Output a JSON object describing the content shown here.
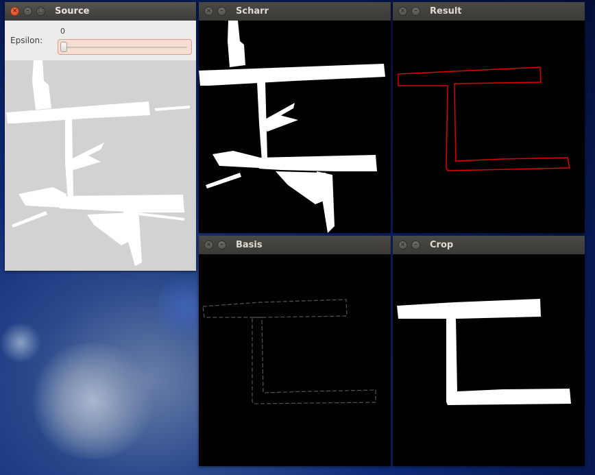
{
  "windows": {
    "source": {
      "title": "Source",
      "trackbar": {
        "label": "Epsilon:",
        "value": "0",
        "fraction": 0
      }
    },
    "scharr": {
      "title": "Scharr"
    },
    "result": {
      "title": "Result"
    },
    "basis": {
      "title": "Basis"
    },
    "crop": {
      "title": "Crop"
    }
  },
  "icons": {
    "close": "close-icon",
    "minimize": "minimize-icon",
    "maximize": "maximize-icon"
  },
  "colors": {
    "contour": "#e00000",
    "accent_close": "#e05a2b",
    "slider_fill": "#f7ddd3"
  }
}
